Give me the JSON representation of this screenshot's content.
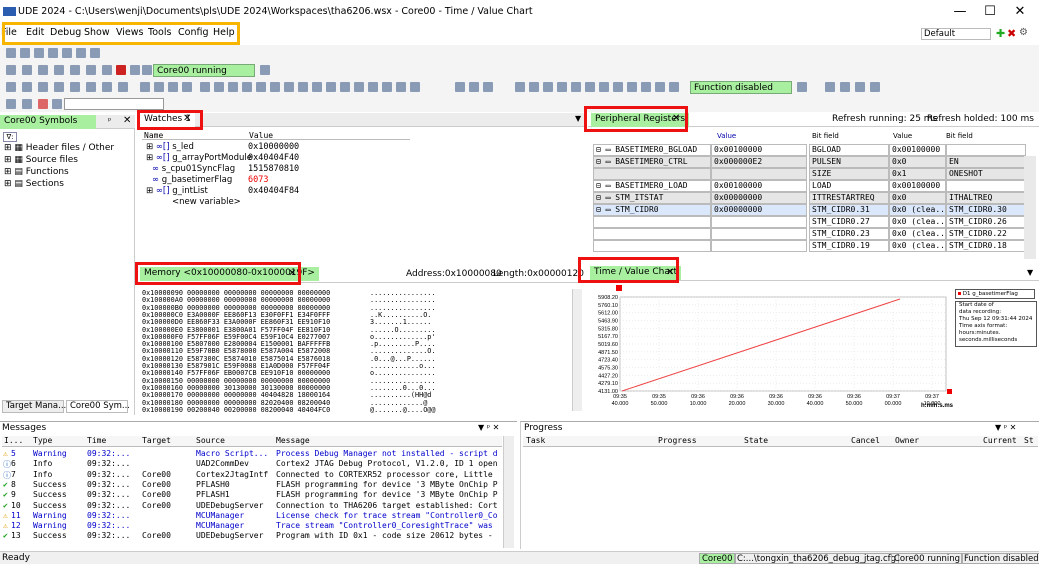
{
  "window": {
    "title": "UDE 2024 - C:\\Users\\wenji\\Documents\\pls\\UDE 2024\\Workspaces\\tha6206.wsx - Core00 - Time / Value Chart",
    "minimize": "—",
    "maximize": "☐",
    "close": "✕"
  },
  "menu": [
    "File",
    "Edit",
    "Debug",
    "Show",
    "Views",
    "Tools",
    "Config",
    "Help"
  ],
  "layout_select": "Default",
  "toolbar": {
    "core_status": "Core00 running",
    "function_status": "Function disabled"
  },
  "symbols": {
    "title": "Core00 Symbols",
    "items": [
      "Header files / Other",
      "Source files",
      "Functions",
      "Sections"
    ],
    "tabs": [
      "Target Mana...",
      "Core00 Sym..."
    ]
  },
  "watches": {
    "title": "Watches 1",
    "col_name": "Name",
    "col_value": "Value",
    "rows": [
      {
        "name": "s_led",
        "value": "0x10000000"
      },
      {
        "name": "g_arrayPortModule",
        "value": "0x40404F40"
      },
      {
        "name": "s_cpu01SyncFlag",
        "value": "1515870810"
      },
      {
        "name": "g_basetimerFlag",
        "value": "6073"
      },
      {
        "name": "g_intList",
        "value": "0x40404F84"
      }
    ],
    "new_var": "<new variable>"
  },
  "peripheral": {
    "title": "Peripheral Registers",
    "refresh_running": "Refresh running: 25 ms",
    "refresh_holded": "Refresh holded: 100 ms",
    "col_value": "Value",
    "col_bitfield": "Bit field",
    "col_value2": "Value",
    "col_bitfield2": "Bit field",
    "rows": [
      {
        "name": "BASETIMER0_BGLOAD",
        "value": "0x00100000",
        "bf": "BGLOAD",
        "bv": "0x00100000",
        "bf2": ""
      },
      {
        "name": "BASETIMER0_CTRL",
        "value": "0x000000E2",
        "bf": "PULSEN",
        "bv": "0x0",
        "bf2": "EN"
      },
      {
        "name": "",
        "value": "",
        "bf": "SIZE",
        "bv": "0x1",
        "bf2": "ONESHOT"
      },
      {
        "name": "BASETIMER0_LOAD",
        "value": "0x00100000",
        "bf": "LOAD",
        "bv": "0x00100000",
        "bf2": ""
      },
      {
        "name": "STM_ITSTAT",
        "value": "0x00000000",
        "bf": "ITTRESTARTREQ",
        "bv": "0x0",
        "bf2": "ITHALTREQ"
      },
      {
        "name": "STM_CIDR0",
        "value": "0x00000000",
        "bf": "STM_CIDR0.31",
        "bv": "0x0 (clea...",
        "bf2": "STM_CIDR0.30"
      },
      {
        "name": "",
        "value": "",
        "bf": "STM_CIDR0.27",
        "bv": "0x0 (clea...",
        "bf2": "STM_CIDR0.26"
      },
      {
        "name": "",
        "value": "",
        "bf": "STM_CIDR0.23",
        "bv": "0x0 (clea...",
        "bf2": "STM_CIDR0.22"
      },
      {
        "name": "",
        "value": "",
        "bf": "STM_CIDR0.19",
        "bv": "0x0 (clea...",
        "bf2": "STM_CIDR0.18"
      }
    ]
  },
  "memory": {
    "title": "Memory <0x10000080-0x1000019F>",
    "address": "Address:0x10000080",
    "length": "Length:0x00000120",
    "rows": [
      "0x10000090   00000000 00000000 00000000 00000000",
      "0x100000A0   00000000 00000000 00000000 00000000",
      "0x100000B0   00000000 00000000 00000000 00000000",
      "0x100000C0   E3A0000F EE860F13 E30F0FF1 E34F0FFF",
      "0x100000D0   EE860F33 E3A0000F EE860F31 EE910F10",
      "0x100000E0   E3800001 E3800A01 F57FF04F EE810F10",
      "0x100000F0   F57FF06F E59F00C4 E59F10C4 E0277007",
      "0x10000100   E5807000 E2800004 E1500001 BAFFFFFB",
      "0x10000110   E59F70B0 E5878000 E587A004 E5872008",
      "0x10000120   E587300C E5874010 E5875014 E5876018",
      "0x10000130   E587901C E59F0088 E1A0D000 F57FF04F",
      "0x10000140   F57FF06F EB0007CB EE910F10 00000000",
      "0x10000150   00000000 00000000 00000000 00000000",
      "0x10000160   00000000 30130000 30130000 00000000",
      "0x10000170   00000000 00000000 40404828 18000164",
      "0x10000180   00000000 00000000 82020400 08200040",
      "0x10000190   00200040 00200000 08200040 40404FC0"
    ],
    "ascii": [
      "................",
      "................",
      "................",
      "..K..........O.",
      "3.......1......",
      "......O.........",
      "o.............p'",
      ".p.........P....",
      "..............O.",
      ".0...@...P......",
      "............o...",
      "o...............",
      "................",
      "........0...0...",
      "..........(HH@d",
      ".............@",
      "@.......@....O@@"
    ]
  },
  "timechart": {
    "title": "Time / Value Chart",
    "legend_series": "D1 g_basetimerFlag",
    "info": [
      "Start date of",
      "data recording:",
      "Thu Sep 12 09:31:44 2024",
      "Time axis format:",
      "hours:minutes.",
      "seconds.milliseconds"
    ],
    "y_ticks": [
      "5908.20",
      "5760.10",
      "5612.00",
      "5463.90",
      "5315.80",
      "5167.70",
      "5019.60",
      "4871.50",
      "4723.40",
      "4575.30",
      "4427.20",
      "4279.10",
      "4131.00"
    ],
    "x_ticks": [
      [
        "09:35",
        "40.000"
      ],
      [
        "09:35",
        "50.000"
      ],
      [
        "09:36",
        "10.000"
      ],
      [
        "09:36",
        "20.000"
      ],
      [
        "09:36",
        "30.000"
      ],
      [
        "09:36",
        "40.000"
      ],
      [
        "09:36",
        "50.000"
      ],
      [
        "09:37",
        "00.000"
      ],
      [
        "09:37",
        "10.000"
      ]
    ],
    "x_unit": "h:min:s.ms"
  },
  "chart_data": {
    "type": "line",
    "title": "",
    "xlabel": "h:min:s.ms",
    "ylabel": "",
    "ylim": [
      4131.0,
      5908.2
    ],
    "series": [
      {
        "name": "D1 g_basetimerFlag",
        "x": [
          "09:35:40.000",
          "09:37:07.000"
        ],
        "values": [
          4131.0,
          5908.2
        ]
      }
    ]
  },
  "messages": {
    "title": "Messages",
    "cols": [
      "I...",
      "Type",
      "Time",
      "Target",
      "Source",
      "Message"
    ],
    "rows": [
      {
        "id": "5",
        "type": "Warning",
        "time": "09:32:...",
        "target": "",
        "source": "Macro Script...",
        "msg": "Process Debug Manager not installed - script d",
        "kind": "warn"
      },
      {
        "id": "6",
        "type": "Info",
        "time": "09:32:...",
        "target": "",
        "source": "UAD2CommDev",
        "msg": "Cortex2 JTAG Debug Protocol, V1.2.0, ID 1 open",
        "kind": "info"
      },
      {
        "id": "7",
        "type": "Info",
        "time": "09:32:...",
        "target": "Core00",
        "source": "Cortex2JtagIntf",
        "msg": "Connected to CORTEXR52 processor core, Little",
        "kind": "info"
      },
      {
        "id": "8",
        "type": "Success",
        "time": "09:32:...",
        "target": "Core00",
        "source": "PFLASH0",
        "msg": "FLASH programming for device '3 MByte OnChip P",
        "kind": "ok"
      },
      {
        "id": "9",
        "type": "Success",
        "time": "09:32:...",
        "target": "Core00",
        "source": "PFLASH1",
        "msg": "FLASH programming for device '3 MByte OnChip P",
        "kind": "ok"
      },
      {
        "id": "10",
        "type": "Success",
        "time": "09:32:...",
        "target": "Core00",
        "source": "UDEDebugServer",
        "msg": "Connection to THA6206 target established: Cort",
        "kind": "ok"
      },
      {
        "id": "11",
        "type": "Warning",
        "time": "09:32:...",
        "target": "",
        "source": "MCUManager",
        "msg": "License check for trace stream \"Controller0_Co",
        "kind": "warn"
      },
      {
        "id": "12",
        "type": "Warning",
        "time": "09:32:...",
        "target": "",
        "source": "MCUManager",
        "msg": "Trace stream \"Controller0_CoresightTrace\" was",
        "kind": "warn"
      },
      {
        "id": "13",
        "type": "Success",
        "time": "09:32:...",
        "target": "Core00",
        "source": "UDEDebugServer",
        "msg": "Program with ID 0x1 - code size 20612 bytes -",
        "kind": "ok"
      }
    ]
  },
  "progress": {
    "title": "Progress",
    "cols": [
      "Task",
      "Progress",
      "State",
      "Cancel",
      "Owner",
      "Current",
      "St"
    ]
  },
  "status": {
    "ready": "Ready",
    "core": "Core00",
    "cfg": "C:...\\tongxin_tha6206_debug_jtag.cfg",
    "running": "Core00 running",
    "func": "Function disabled"
  }
}
